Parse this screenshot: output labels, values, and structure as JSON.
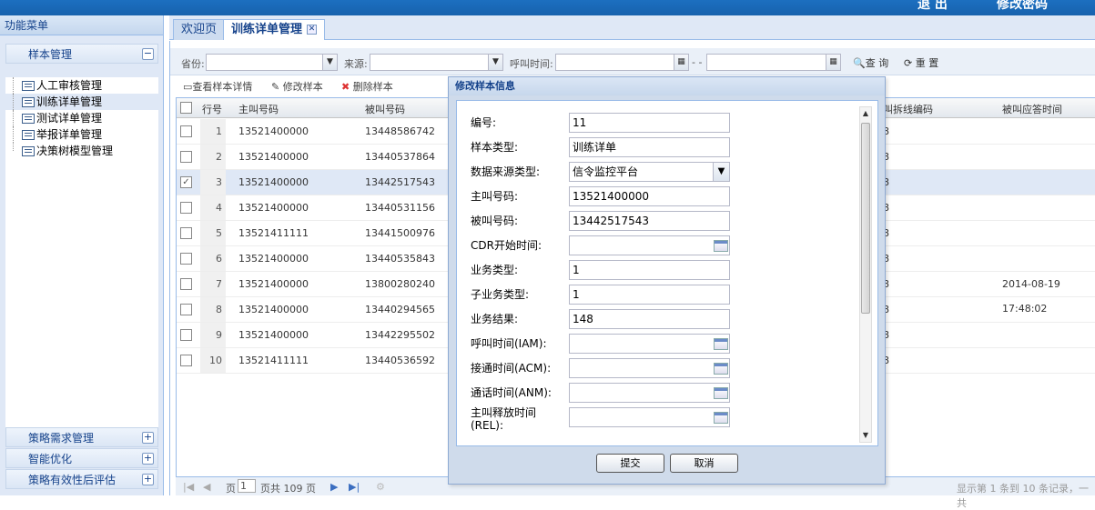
{
  "topbar": {
    "items": [
      "退 出",
      "修改密码"
    ]
  },
  "left": {
    "header": "功能菜单",
    "sections": [
      {
        "label": "样本管理",
        "toggle": "−"
      },
      {
        "label": "策略需求管理",
        "toggle": "+"
      },
      {
        "label": "智能优化",
        "toggle": "+"
      },
      {
        "label": "策略有效性后评估",
        "toggle": "+"
      }
    ],
    "tree": [
      "人工审核管理",
      "训练详单管理",
      "测试详单管理",
      "举报详单管理",
      "决策树模型管理"
    ]
  },
  "tabs": [
    {
      "label": "欢迎页"
    },
    {
      "label": "训练详单管理"
    }
  ],
  "filter": {
    "province_label": "省份:",
    "source_label": "来源:",
    "calltime_label": "呼叫时间:",
    "range_sep": "- -",
    "search_label": "查 询",
    "reset_label": "重 置"
  },
  "toolbar": {
    "view": "查看样本详情",
    "edit": "修改样本",
    "delete": "删除样本"
  },
  "grid": {
    "headers": {
      "rownum": "行号",
      "caller": "主叫号码",
      "callee": "被叫号码",
      "release_code": "叫拆线编码",
      "answer_time": "被叫应答时间"
    },
    "rows": [
      {
        "n": "1",
        "caller": "13521400000",
        "callee": "13448586742",
        "code": "8",
        "answer": "",
        "checked": ""
      },
      {
        "n": "2",
        "caller": "13521400000",
        "callee": "13440537864",
        "code": "8",
        "answer": "",
        "checked": ""
      },
      {
        "n": "3",
        "caller": "13521400000",
        "callee": "13442517543",
        "code": "8",
        "answer": "",
        "checked": "✓"
      },
      {
        "n": "4",
        "caller": "13521400000",
        "callee": "13440531156",
        "code": "8",
        "answer": "",
        "checked": ""
      },
      {
        "n": "5",
        "caller": "13521411111",
        "callee": "13441500976",
        "code": "8",
        "answer": "",
        "checked": ""
      },
      {
        "n": "6",
        "caller": "13521400000",
        "callee": "13440535843",
        "code": "8",
        "answer": "",
        "checked": ""
      },
      {
        "n": "7",
        "caller": "13521400000",
        "callee": "13800280240",
        "code": "8",
        "answer": "2014-08-19 17:48:02",
        "checked": ""
      },
      {
        "n": "8",
        "caller": "13521400000",
        "callee": "13440294565",
        "code": "8",
        "answer": "",
        "checked": ""
      },
      {
        "n": "9",
        "caller": "13521400000",
        "callee": "13442295502",
        "code": "8",
        "answer": "",
        "checked": ""
      },
      {
        "n": "10",
        "caller": "13521411111",
        "callee": "13440536592",
        "code": "8",
        "answer": "",
        "checked": ""
      }
    ]
  },
  "pager": {
    "page_label": "页",
    "page_value": "1",
    "total": "页共 109 页",
    "display": "显示第 1 条到 10 条记录，一共"
  },
  "modal": {
    "title": "修改样本信息",
    "fields": [
      {
        "label": "编号:",
        "value": "11"
      },
      {
        "label": "样本类型:",
        "value": "训练详单"
      },
      {
        "label": "数据来源类型:",
        "value": "信令监控平台"
      },
      {
        "label": "主叫号码:",
        "value": "13521400000"
      },
      {
        "label": "被叫号码:",
        "value": "13442517543"
      },
      {
        "label": "CDR开始时间:",
        "value": ""
      },
      {
        "label": "业务类型:",
        "value": "1"
      },
      {
        "label": "子业务类型:",
        "value": "1"
      },
      {
        "label": "业务结果:",
        "value": "148"
      },
      {
        "label": "呼叫时间(IAM):",
        "value": ""
      },
      {
        "label": "接通时间(ACM):",
        "value": ""
      },
      {
        "label": "通话时间(ANM):",
        "value": ""
      },
      {
        "label": "主叫释放时间(REL):",
        "value": ""
      }
    ],
    "submit": "提交",
    "cancel": "取消"
  }
}
